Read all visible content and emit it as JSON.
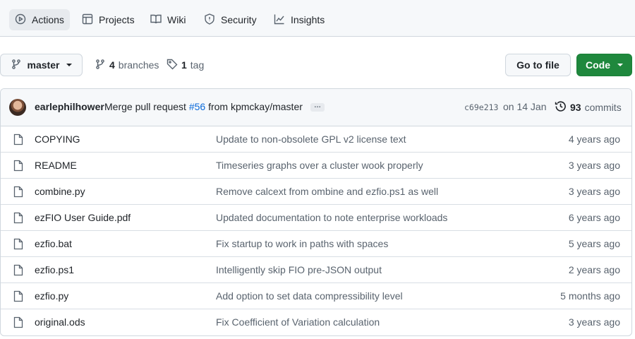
{
  "nav": {
    "tabs": [
      {
        "label": "Actions",
        "icon": "play-circle-icon",
        "active": true
      },
      {
        "label": "Projects",
        "icon": "table-icon",
        "active": false
      },
      {
        "label": "Wiki",
        "icon": "book-icon",
        "active": false
      },
      {
        "label": "Security",
        "icon": "shield-icon",
        "active": false
      },
      {
        "label": "Insights",
        "icon": "graph-icon",
        "active": false
      }
    ]
  },
  "branch": {
    "current": "master",
    "branches_count": "4",
    "branches_label": "branches",
    "tags_count": "1",
    "tags_label": "tag"
  },
  "actions": {
    "go_to_file": "Go to file",
    "code": "Code"
  },
  "colors": {
    "primary_button": "#1f883d",
    "link": "#0969da"
  },
  "latest_commit": {
    "author": "earlephilhower",
    "message_prefix": "Merge pull request ",
    "pr": "#56",
    "message_suffix": " from kpmckay/master",
    "more": "…",
    "sha": "c69e213",
    "date": "on 14 Jan",
    "commits_count": "93",
    "commits_label": "commits"
  },
  "files": [
    {
      "name": "COPYING",
      "message": "Update to non-obsolete GPL v2 license text",
      "age": "4 years ago"
    },
    {
      "name": "README",
      "message": "Timeseries graphs over a cluster wook properly",
      "age": "3 years ago"
    },
    {
      "name": "combine.py",
      "message": "Remove calcext from ombine and ezfio.ps1 as well",
      "age": "3 years ago"
    },
    {
      "name": "ezFIO User Guide.pdf",
      "message": "Updated documentation to note enterprise workloads",
      "age": "6 years ago"
    },
    {
      "name": "ezfio.bat",
      "message": "Fix startup to work in paths with spaces",
      "age": "5 years ago"
    },
    {
      "name": "ezfio.ps1",
      "message": "Intelligently skip FIO pre-JSON output",
      "age": "2 years ago"
    },
    {
      "name": "ezfio.py",
      "message": "Add option to set data compressibility level",
      "age": "5 months ago"
    },
    {
      "name": "original.ods",
      "message": "Fix Coefficient of Variation calculation",
      "age": "3 years ago"
    }
  ]
}
